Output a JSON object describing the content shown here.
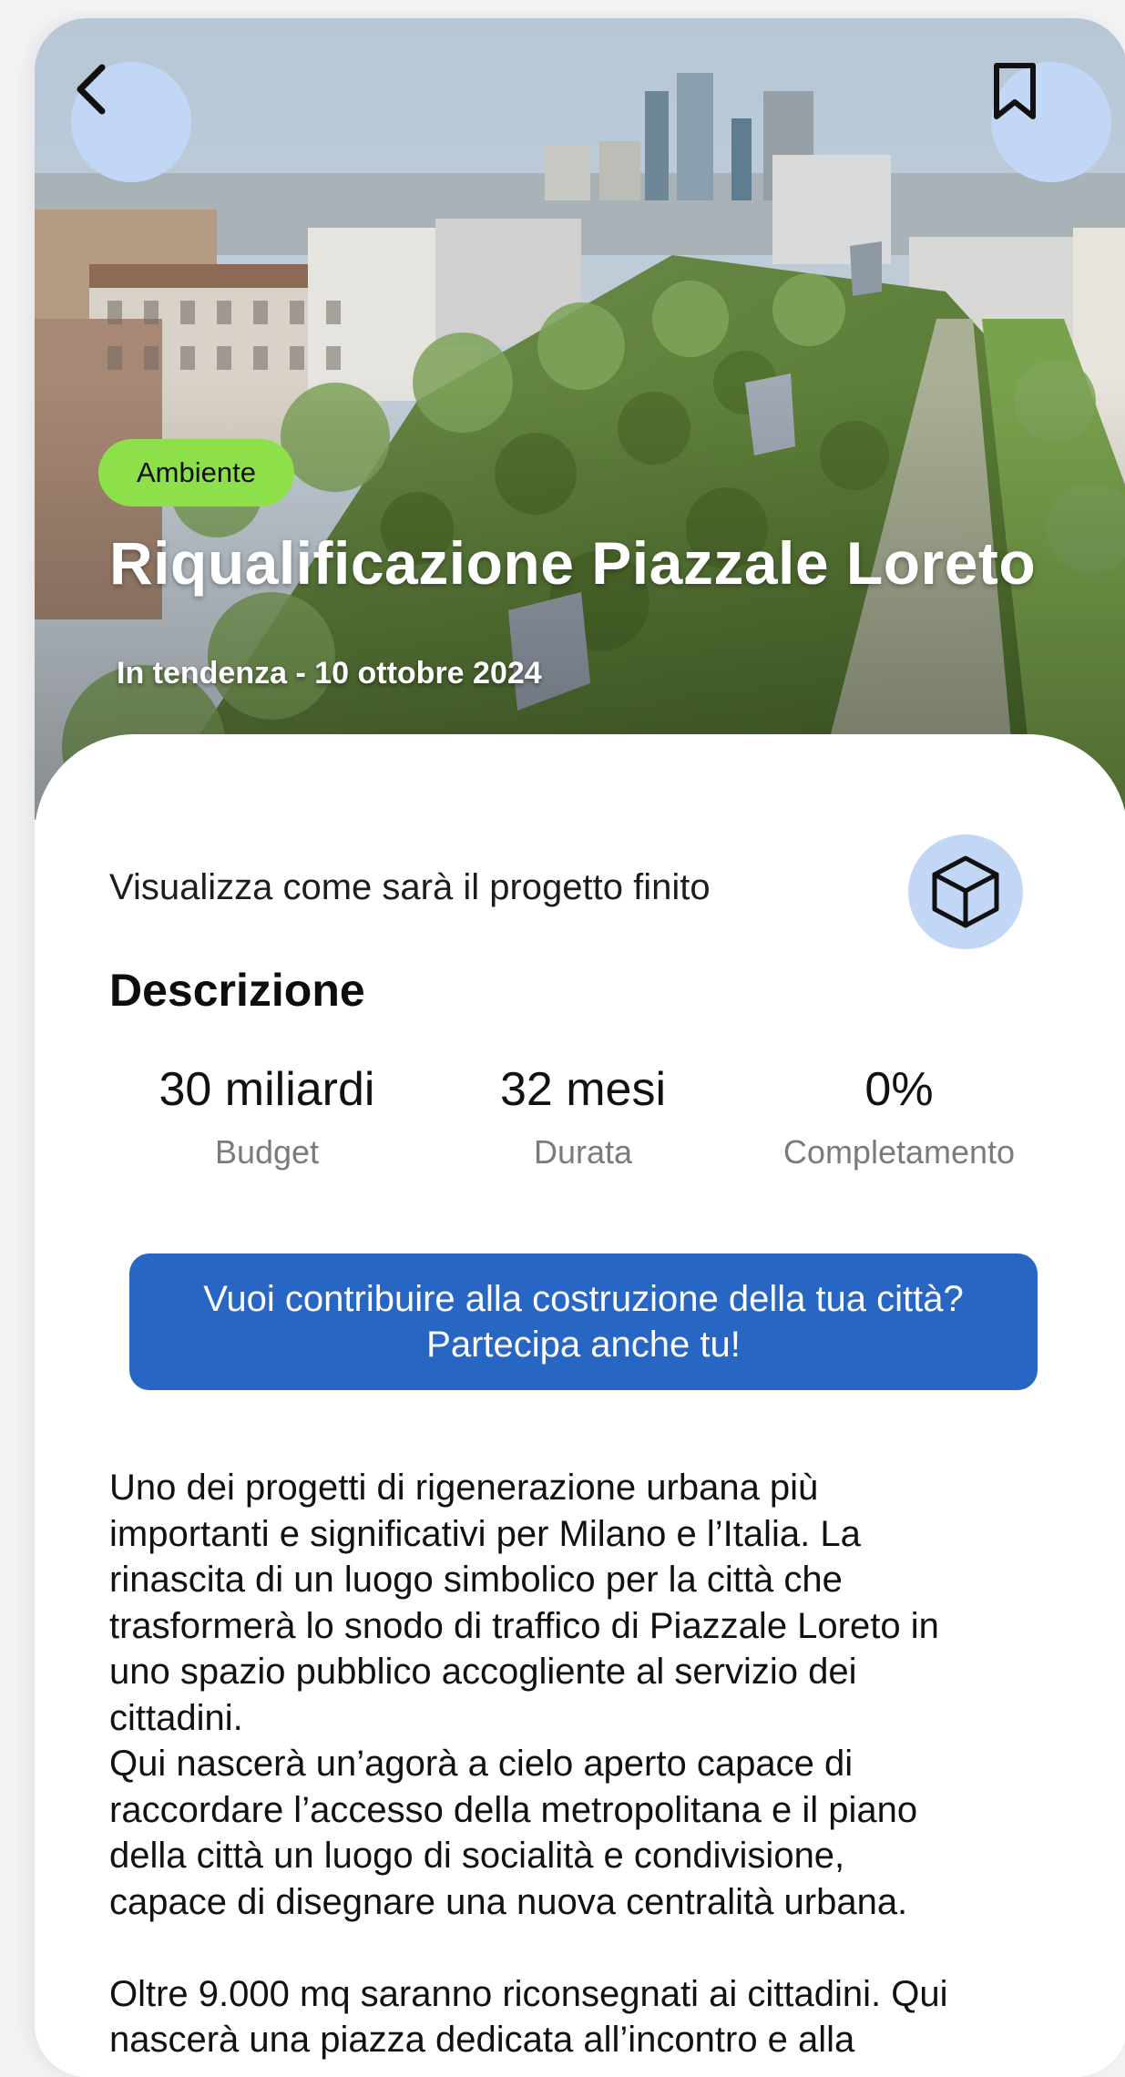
{
  "hero": {
    "back_icon": "chevron-left-icon",
    "bookmark_icon": "bookmark-icon",
    "category": "Ambiente",
    "title": "Riqualificazione Piazzale Loreto",
    "meta": "In tendenza - 10 ottobre 2024"
  },
  "preview": {
    "label": "Visualizza come sarà il progetto finito",
    "icon": "cube-icon"
  },
  "description": {
    "title": "Descrizione",
    "stats": [
      {
        "value": "30 miliardi",
        "label": "Budget"
      },
      {
        "value": "32 mesi",
        "label": "Durata"
      },
      {
        "value": "0%",
        "label": "Completamento"
      }
    ],
    "cta_label": "Vuoi contribuire alla costruzione della tua città? Partecipa anche tu!",
    "body": "Uno dei progetti di rigenerazione urbana più\nimportanti e significativi per Milano e l’Italia. La\nrinascita di un luogo simbolico per la città che\ntrasformerà lo snodo di traffico di Piazzale Loreto in\nuno spazio pubblico accogliente al servizio dei\ncittadini.\nQui nascerà un’agorà a cielo aperto capace di\nraccordare l’accesso della metropolitana e il piano\ndella città un luogo di socialità e condivisione,\ncapace di disegnare una nuova centralità urbana.\n\nOltre 9.000 mq saranno riconsegnati ai cittadini. Qui\nnascerà una piazza dedicata all’incontro e alla"
  },
  "colors": {
    "accent_blue": "#2766c3",
    "icon_button_bg": "#c2d7f6",
    "tag_green": "#8ee04a"
  }
}
